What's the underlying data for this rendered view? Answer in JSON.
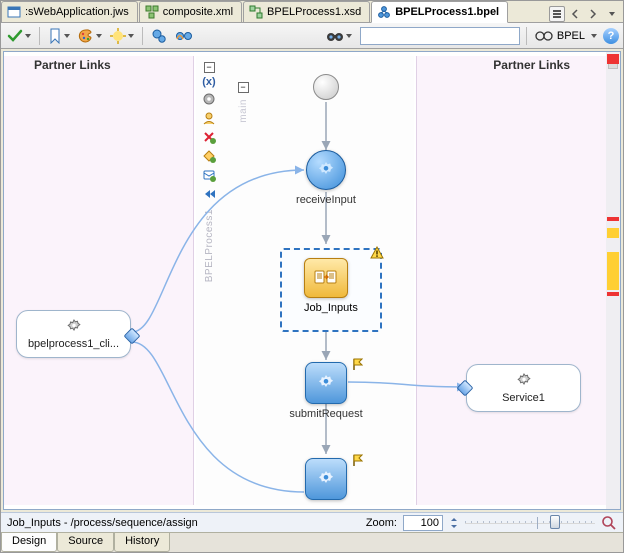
{
  "tabs": {
    "items": [
      {
        "label": ":sWebApplication.jws",
        "icon": "app-icon",
        "active": false
      },
      {
        "label": "composite.xml",
        "icon": "composite-icon",
        "active": false
      },
      {
        "label": "BPELProcess1.xsd",
        "icon": "xsd-icon",
        "active": false
      },
      {
        "label": "BPELProcess1.bpel",
        "icon": "bpel-icon",
        "active": true
      }
    ],
    "list_button": "tab-list"
  },
  "toolbar": {
    "language_label": "BPEL",
    "search_placeholder": ""
  },
  "partner_links": {
    "left_header": "Partner Links",
    "right_header": "Partner Links",
    "left": {
      "name": "bpelprocess1_cli..."
    },
    "right": {
      "name": "Service1"
    }
  },
  "process": {
    "palette_label": "BPELProcess1",
    "scope_label": "main",
    "activities": {
      "receive": "receiveInput",
      "assign": "Job_Inputs",
      "invoke": "submitRequest"
    }
  },
  "status": {
    "breadcrumb": "Job_Inputs - /process/sequence/assign",
    "zoom_label": "Zoom:",
    "zoom_value": "100"
  },
  "bottom_tabs": {
    "design": "Design",
    "source": "Source",
    "history": "History"
  }
}
